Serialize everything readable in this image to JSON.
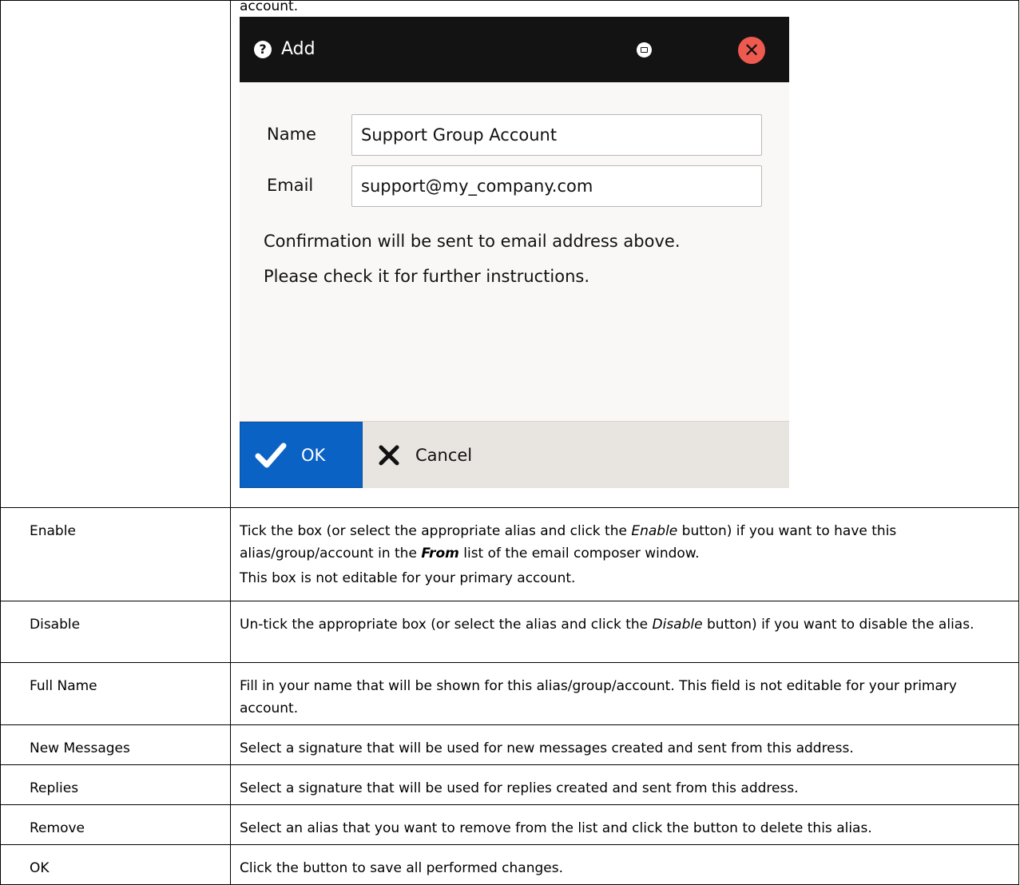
{
  "intro": {
    "text": "account."
  },
  "dialog": {
    "title": "Add",
    "name_label": "Name",
    "name_value": "Support Group Account",
    "email_label": "Email",
    "email_value": "support@my_company.com",
    "note_line1": "Confirmation will be sent to email address above.",
    "note_line2": "Please check it for further instructions.",
    "ok_label": "OK",
    "cancel_label": "Cancel"
  },
  "rows": [
    {
      "term": "Enable",
      "p1_a": "Tick the box (or select the appropriate alias and click the ",
      "p1_em": "Enable",
      "p1_b": " button) if you want to have this alias/group/account in the ",
      "p1_strong": "From",
      "p1_c": " list of the email composer window.",
      "p2": "This box is not editable for your primary account."
    },
    {
      "term": "Disable",
      "p1_a": "Un-tick the appropriate box (or select the alias and click the ",
      "p1_em": "Disable",
      "p1_b": " button) if you want to disable the alias."
    },
    {
      "term": "Full Name",
      "desc": "Fill in your name that will be shown for this alias/group/account. This field is not editable for your primary account."
    },
    {
      "term": "New Messages",
      "desc": "Select a signature that will be used for new messages created and sent from this address."
    },
    {
      "term": "Replies",
      "desc": "Select a signature that will be used for replies created and sent from this address."
    },
    {
      "term": "Remove",
      "desc": "Select an alias that you want to remove from the list and click the button to delete this alias."
    },
    {
      "term": "OK",
      "desc": "Click the button to save all performed changes."
    }
  ],
  "colors": {
    "titlebar": "#131313",
    "ok_button": "#0a62c4",
    "close_button": "#ee5a4f",
    "footer": "#e8e4df"
  },
  "icons": [
    "help-icon",
    "maximize-icon",
    "close-icon",
    "check-icon",
    "x-icon"
  ]
}
